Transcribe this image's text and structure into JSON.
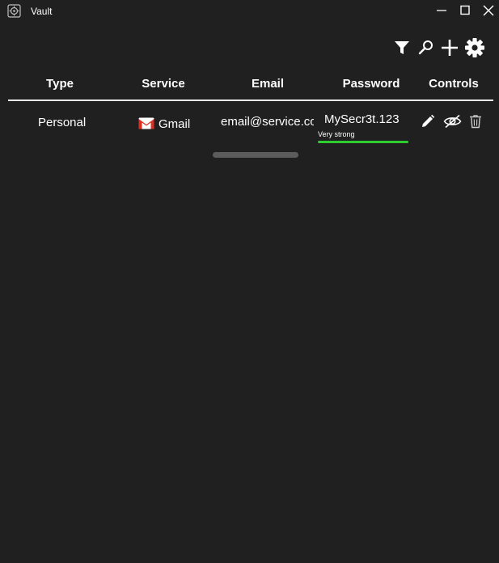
{
  "window": {
    "title": "Vault"
  },
  "toolbar": {
    "filter_icon": "filter-icon",
    "search_icon": "search-icon",
    "add_icon": "plus-icon",
    "settings_icon": "gear-icon"
  },
  "table": {
    "columns": [
      "Type",
      "Service",
      "Email",
      "Password",
      "Controls"
    ],
    "rows": [
      {
        "type": "Personal",
        "service": "Gmail",
        "service_icon": "gmail-icon",
        "email": "email@service.com",
        "password": "MySecr3t.123",
        "strength_label": "Very strong",
        "strength_value": 1.0,
        "controls": [
          "edit-icon",
          "eye-icon",
          "trash-icon"
        ]
      }
    ]
  },
  "colors": {
    "background": "#202020",
    "strength_bar": "#2ecc2e",
    "gmail_red": "#d93025"
  }
}
